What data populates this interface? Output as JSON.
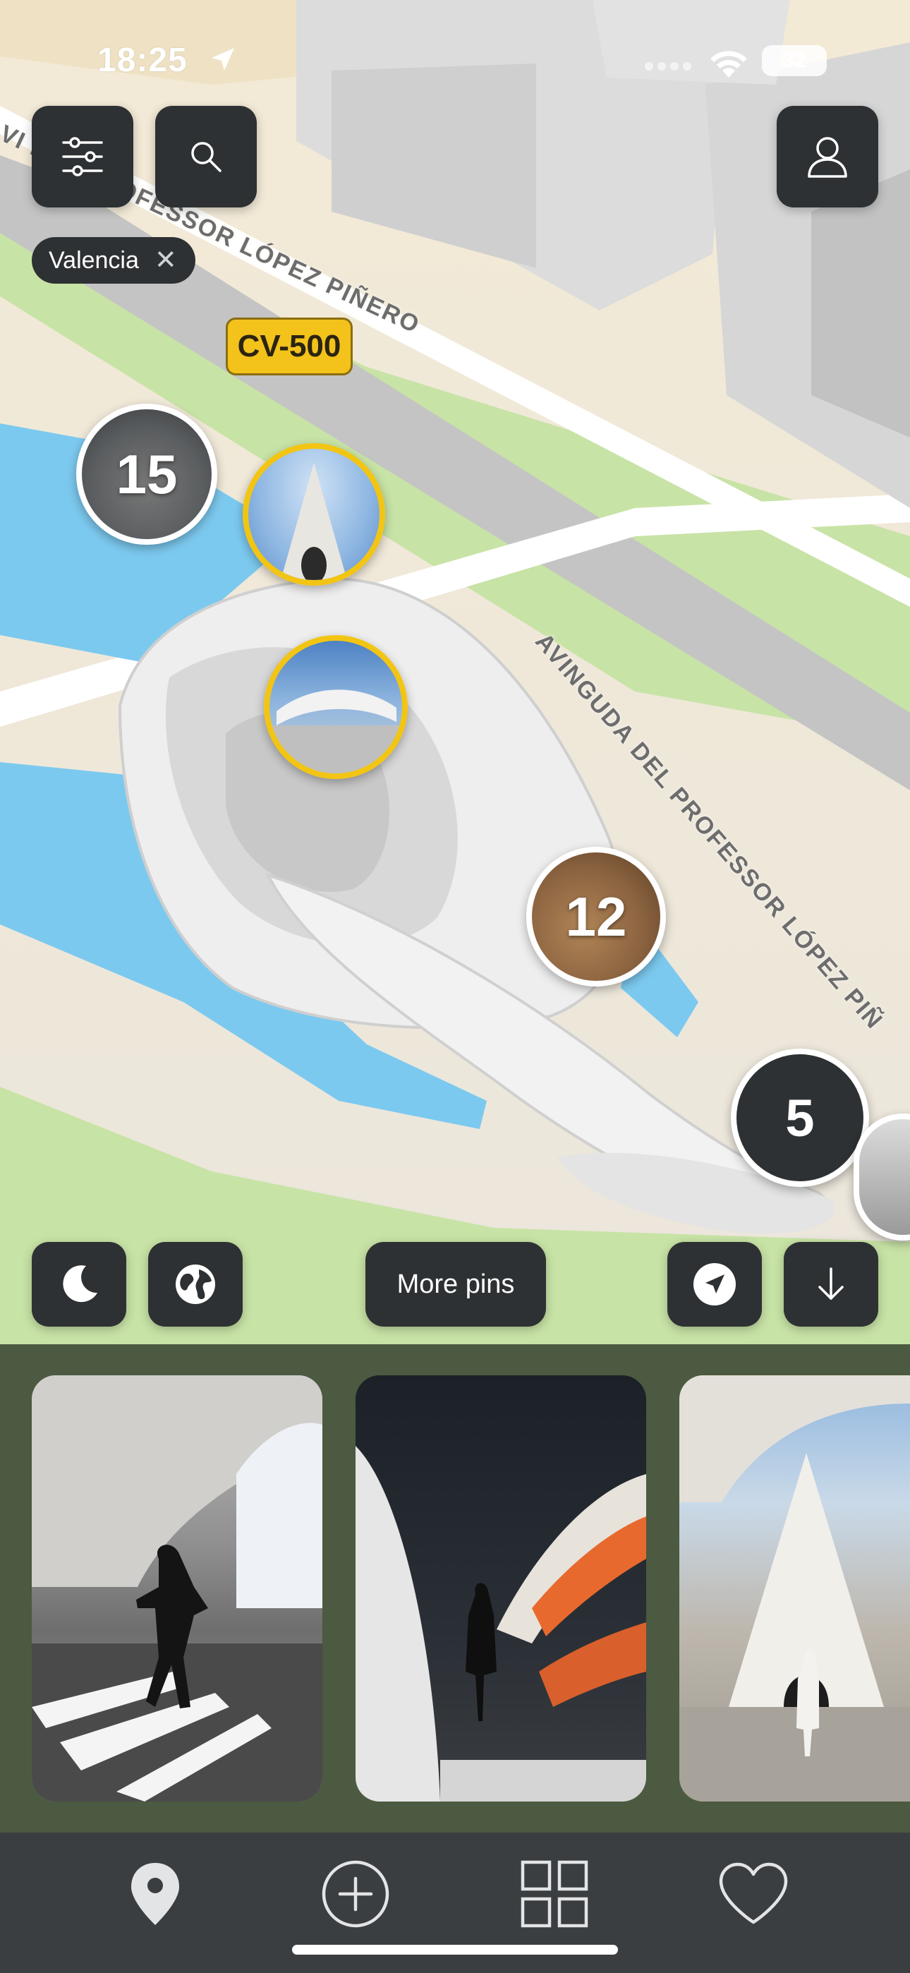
{
  "status_bar": {
    "time": "18:25",
    "battery": "32"
  },
  "filter_chip": {
    "label": "Valencia",
    "remove_symbol": "✕"
  },
  "map_labels": {
    "road_sign": "CV-500",
    "street_top": "DEL PROFESSOR LÓPEZ PIÑERO",
    "street_top_prefix": "VI",
    "street_diagonal": "AVINGUDA DEL PROFESSOR LÓPEZ PIÑ"
  },
  "pins": {
    "cluster_a": "15",
    "cluster_b": "12",
    "cluster_c": "5"
  },
  "map_controls": {
    "more_pins_label": "More pins"
  },
  "icons": {
    "filters": "sliders-icon",
    "search": "search-icon",
    "profile": "user-icon",
    "dark_mode": "moon-icon",
    "globe": "globe-icon",
    "locate": "location-arrow-icon",
    "download": "arrow-down-icon",
    "tab_map": "map-pin-icon",
    "tab_add": "plus-circle-icon",
    "tab_grid": "grid-icon",
    "tab_favorites": "heart-icon"
  },
  "colors": {
    "button_bg": "#2e3133",
    "pin_highlight": "#f2c514",
    "water": "#7cc9ef",
    "park": "#c8e3a6",
    "tab_bar": "#3b3e41",
    "photo_strip": "#4b5a40"
  }
}
